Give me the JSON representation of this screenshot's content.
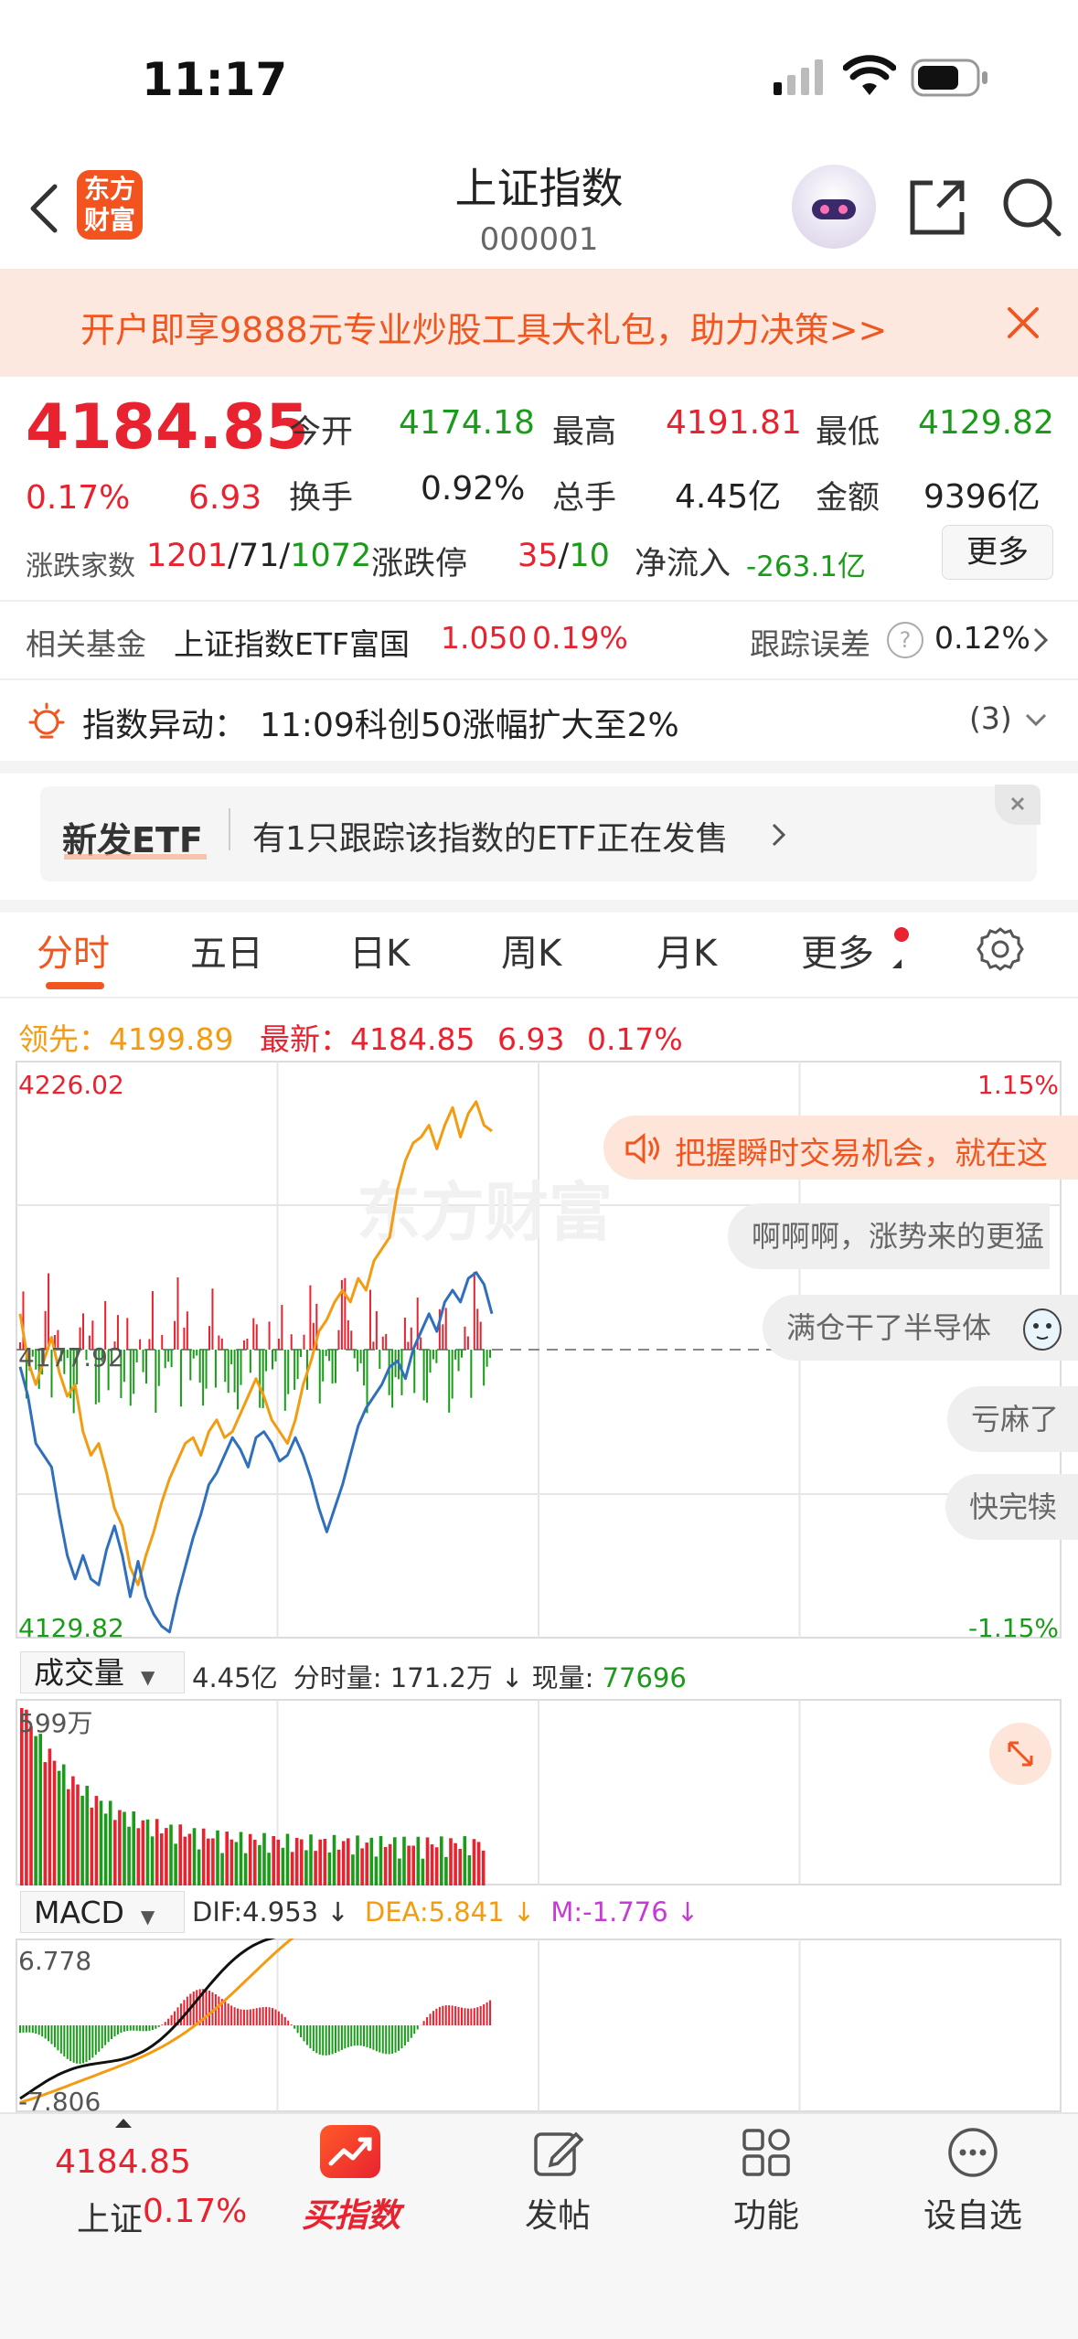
{
  "status_bar": {
    "time": "11:17"
  },
  "header": {
    "title": "上证指数",
    "code": "000001",
    "logo_text_1": "东方",
    "logo_text_2": "财富"
  },
  "banner": {
    "text": "开户即享9888元专业炒股工具大礼包，助力决策>>"
  },
  "quote": {
    "price": "4184.85",
    "change_pct": "0.17%",
    "change": "6.93",
    "open_label": "今开",
    "open": "4174.18",
    "high_label": "最高",
    "high": "4191.81",
    "low_label": "最低",
    "low": "4129.82",
    "turnover_label": "换手",
    "turnover": "0.92%",
    "volume_label": "总手",
    "volume": "4.45亿",
    "amount_label": "金额",
    "amount": "9396亿",
    "breadth_label": "涨跌家数",
    "breadth_up": "1201",
    "breadth_flat": "71",
    "breadth_down": "1072",
    "limit_label": "涨跌停",
    "limit_up": "35",
    "limit_down": "10",
    "netflow_label": "净流入",
    "netflow": "-263.1亿",
    "more_label": "更多"
  },
  "fund": {
    "label": "相关基金",
    "name": "上证指数ETF富国",
    "price": "1.050",
    "pct": "0.19%",
    "tracking_label": "跟踪误差",
    "tracking": "0.12%"
  },
  "anomaly": {
    "label": "指数异动：",
    "text": "11:09科创50涨幅扩大至2%",
    "count": "(3)"
  },
  "etf_card": {
    "title": "新发ETF",
    "text": "有1只跟踪该指数的ETF正在发售"
  },
  "tabs": [
    "分时",
    "五日",
    "日K",
    "周K",
    "月K",
    "更多"
  ],
  "chart_legend": {
    "lead_label": "领先：",
    "lead": "4199.89",
    "latest_label": "最新：",
    "latest": "4184.85",
    "latest_chg": "6.93",
    "latest_pct": "0.17%"
  },
  "bubbles": [
    "把握瞬时交易机会，就在这",
    "啊啊啊，涨势来的更猛",
    "满仓干了半导体",
    "亏麻了",
    "快完犊"
  ],
  "watermark": "东方财富",
  "volume_bar": {
    "selector": "成交量",
    "total": "4.45亿",
    "fs_label": "分时量:",
    "fs_value": "171.2万",
    "cur_label": "现量:",
    "cur_value": "77696",
    "max_label": "599万"
  },
  "macd_bar": {
    "selector": "MACD",
    "dif": "DIF:4.953",
    "dea": "DEA:5.841",
    "m": "M:-1.776",
    "top_label": "6.778",
    "bottom_label": "-7.806"
  },
  "chart_data": {
    "type": "line",
    "yaxis": {
      "top": "4226.02",
      "mid": "4177.92",
      "bottom": "4129.82",
      "top_pct": "1.15%",
      "bottom_pct": "-1.15%"
    },
    "ylim": [
      4129.82,
      4226.02
    ],
    "prev_close": 4177.92,
    "series": [
      {
        "name": "最新",
        "color": "#2f6fbd",
        "values": [
          4175,
          4170,
          4162,
          4160,
          4158,
          4150,
          4143,
          4139,
          4143,
          4139,
          4138,
          4144,
          4148,
          4143,
          4136,
          4142,
          4136,
          4133,
          4131,
          4130,
          4136,
          4141,
          4146,
          4150,
          4155,
          4157,
          4160,
          4163,
          4161,
          4158,
          4163,
          4164,
          4162,
          4159,
          4160,
          4163,
          4160,
          4156,
          4151,
          4147,
          4151,
          4155,
          4160,
          4165,
          4168,
          4170,
          4172,
          4175,
          4176,
          4173,
          4178,
          4181,
          4184,
          4181,
          4186,
          4188,
          4186,
          4190,
          4191,
          4189,
          4184
        ]
      },
      {
        "name": "领先",
        "color": "#f39c12",
        "values": [
          4184,
          4176,
          4172,
          4176,
          4180,
          4174,
          4170,
          4172,
          4164,
          4160,
          4162,
          4157,
          4151,
          4148,
          4141,
          4138,
          4143,
          4147,
          4152,
          4156,
          4159,
          4162,
          4163,
          4160,
          4164,
          4166,
          4163,
          4164,
          4167,
          4170,
          4173,
          4170,
          4166,
          4164,
          4162,
          4166,
          4172,
          4176,
          4181,
          4183,
          4186,
          4188,
          4186,
          4190,
          4188,
          4193,
          4195,
          4197,
          4205,
          4210,
          4213,
          4214,
          4216,
          4212,
          4216,
          4219,
          4214,
          4218,
          4220,
          4216,
          4215
        ]
      }
    ]
  },
  "bottom_nav": {
    "quote_price": "4184.85",
    "quote_name": "上证",
    "quote_pct": "0.17%",
    "buy_index": "买指数",
    "post": "发帖",
    "functions": "功能",
    "watchlist": "设自选"
  }
}
